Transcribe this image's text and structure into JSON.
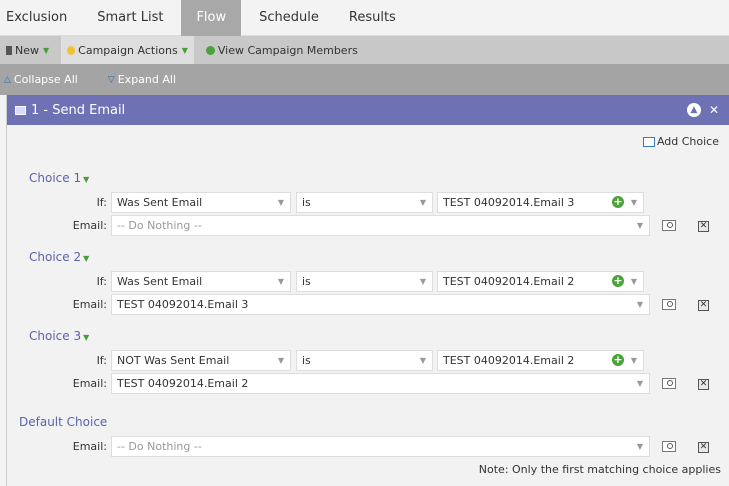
{
  "tabs": [
    {
      "label": "Exclusion"
    },
    {
      "label": "Smart List"
    },
    {
      "label": "Flow",
      "active": true
    },
    {
      "label": "Schedule"
    },
    {
      "label": "Results"
    }
  ],
  "toolbar": {
    "new_label": "New",
    "campaign_actions_label": "Campaign Actions",
    "view_members_label": "View Campaign Members"
  },
  "subbar": {
    "collapse_label": "Collapse All",
    "expand_label": "Expand All"
  },
  "panel": {
    "title": "1 - Send Email",
    "add_choice_label": "Add Choice",
    "if_label": "If:",
    "email_label": "Email:",
    "choices": [
      {
        "title": "Choice 1",
        "condition": "Was Sent Email",
        "operator": "is",
        "value": "TEST 04092014.Email 3",
        "email": "-- Do Nothing --",
        "email_placeholder": true
      },
      {
        "title": "Choice 2",
        "condition": "Was Sent Email",
        "operator": "is",
        "value": "TEST 04092014.Email 2",
        "email": "TEST 04092014.Email 3",
        "email_placeholder": false
      },
      {
        "title": "Choice 3",
        "condition": "NOT Was Sent Email",
        "operator": "is",
        "value": "TEST 04092014.Email 2",
        "email": "TEST 04092014.Email 2",
        "email_placeholder": false
      }
    ],
    "default_choice": {
      "title": "Default Choice",
      "email": "-- Do Nothing --"
    },
    "note": "Note: Only the first matching choice applies"
  },
  "colors": {
    "header": "#6e71b4",
    "link": "#5a64a8",
    "green": "#4aa33a"
  }
}
